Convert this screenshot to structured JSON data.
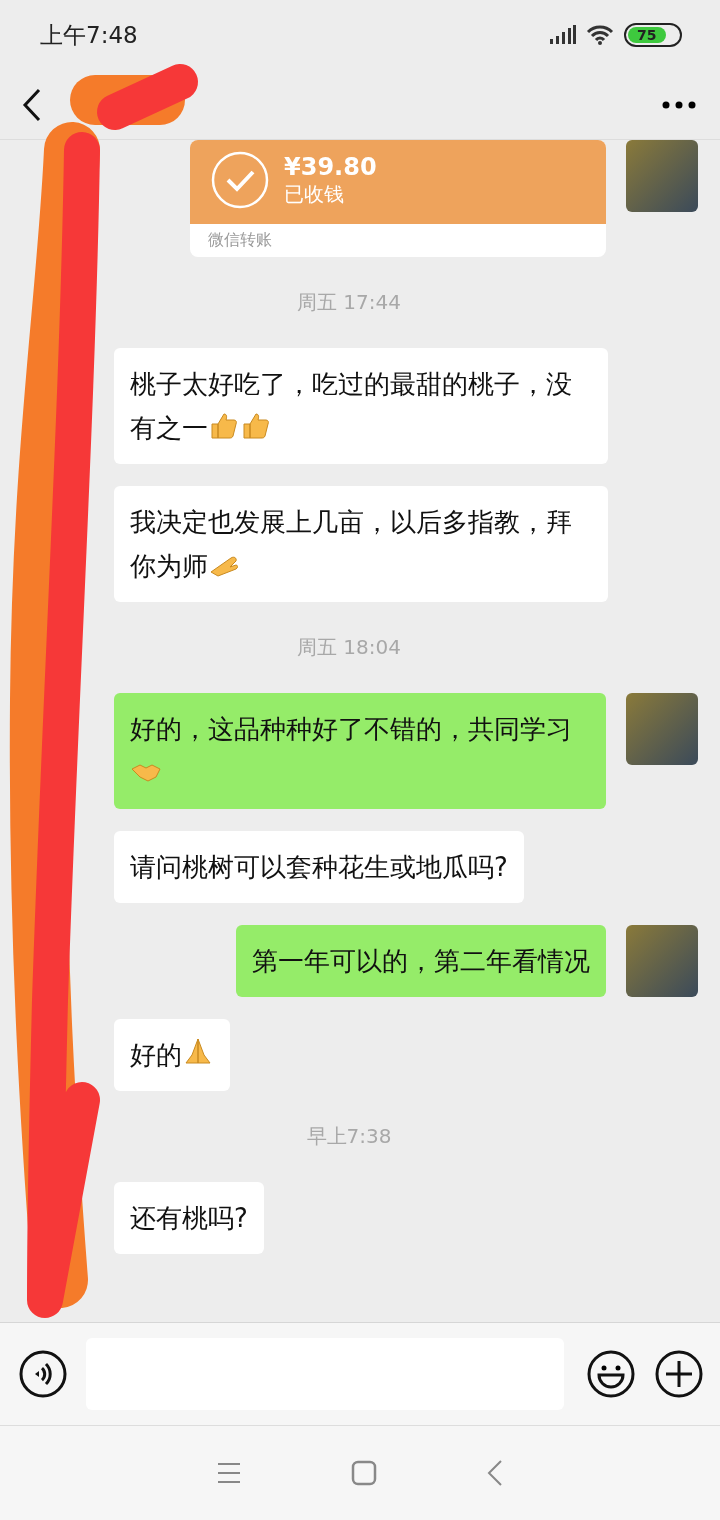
{
  "status_bar": {
    "time": "上午7:48",
    "battery": "75"
  },
  "transfer": {
    "amount": "¥39.80",
    "status": "已收钱",
    "footer": "微信转账"
  },
  "messages": [
    {
      "kind": "time",
      "text": "周五 17:44"
    },
    {
      "kind": "incoming",
      "text": "桃子太好吃了，吃过的最甜的桃子，没有之一",
      "icons": [
        {
          "kind": "thumbs_up"
        },
        {
          "kind": "thumbs_up"
        }
      ]
    },
    {
      "kind": "incoming",
      "text": "我决定也发展上几亩，以后多指教，拜你为师",
      "icons": [
        {
          "kind": "bow_hand"
        }
      ]
    },
    {
      "kind": "time",
      "text": "周五 18:04"
    },
    {
      "kind": "outgoing",
      "text": "好的，这品种种好了不错的，共同学习",
      "icons": [
        {
          "kind": "handshake"
        }
      ]
    },
    {
      "kind": "incoming",
      "text": "请问桃树可以套种花生或地瓜吗?"
    },
    {
      "kind": "outgoing",
      "text": "第一年可以的，第二年看情况"
    },
    {
      "kind": "incoming",
      "text": "好的",
      "icons": [
        {
          "kind": "praying_hands"
        }
      ]
    },
    {
      "kind": "time",
      "text": "早上7:38"
    },
    {
      "kind": "incoming",
      "text": "还有桃吗?"
    }
  ]
}
